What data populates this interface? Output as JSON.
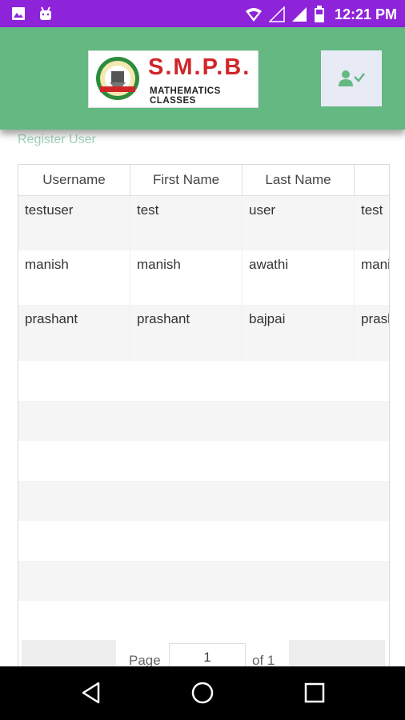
{
  "status_bar": {
    "time": "12:21 PM",
    "left_icons": [
      "image-icon",
      "android-icon"
    ],
    "right_icons": [
      "wifi-icon",
      "signal-empty-icon",
      "signal-icon",
      "battery-icon"
    ]
  },
  "header": {
    "logo": {
      "title": "S.M.P.B.",
      "subtitle": "MATHEMATICS CLASSES"
    },
    "user_menu_icon": "user-check-icon"
  },
  "register_link": "Register User",
  "table": {
    "columns": [
      "Username",
      "First Name",
      "Last Name",
      ""
    ],
    "rows": [
      [
        "testuser",
        "test",
        "user",
        "test"
      ],
      [
        "manish",
        "manish",
        "awathi",
        "manish"
      ],
      [
        "prashant",
        "prashant",
        "bajpai",
        "prashant"
      ]
    ]
  },
  "pagination": {
    "page_label": "Page",
    "page_value": "1",
    "of_label": "of 1"
  },
  "colors": {
    "status_bar": "#8e24d9",
    "app_bar": "#64b882",
    "link": "#9ed3b4"
  },
  "nav_bar": {
    "icons": [
      "back-icon",
      "home-icon",
      "recents-icon"
    ]
  }
}
